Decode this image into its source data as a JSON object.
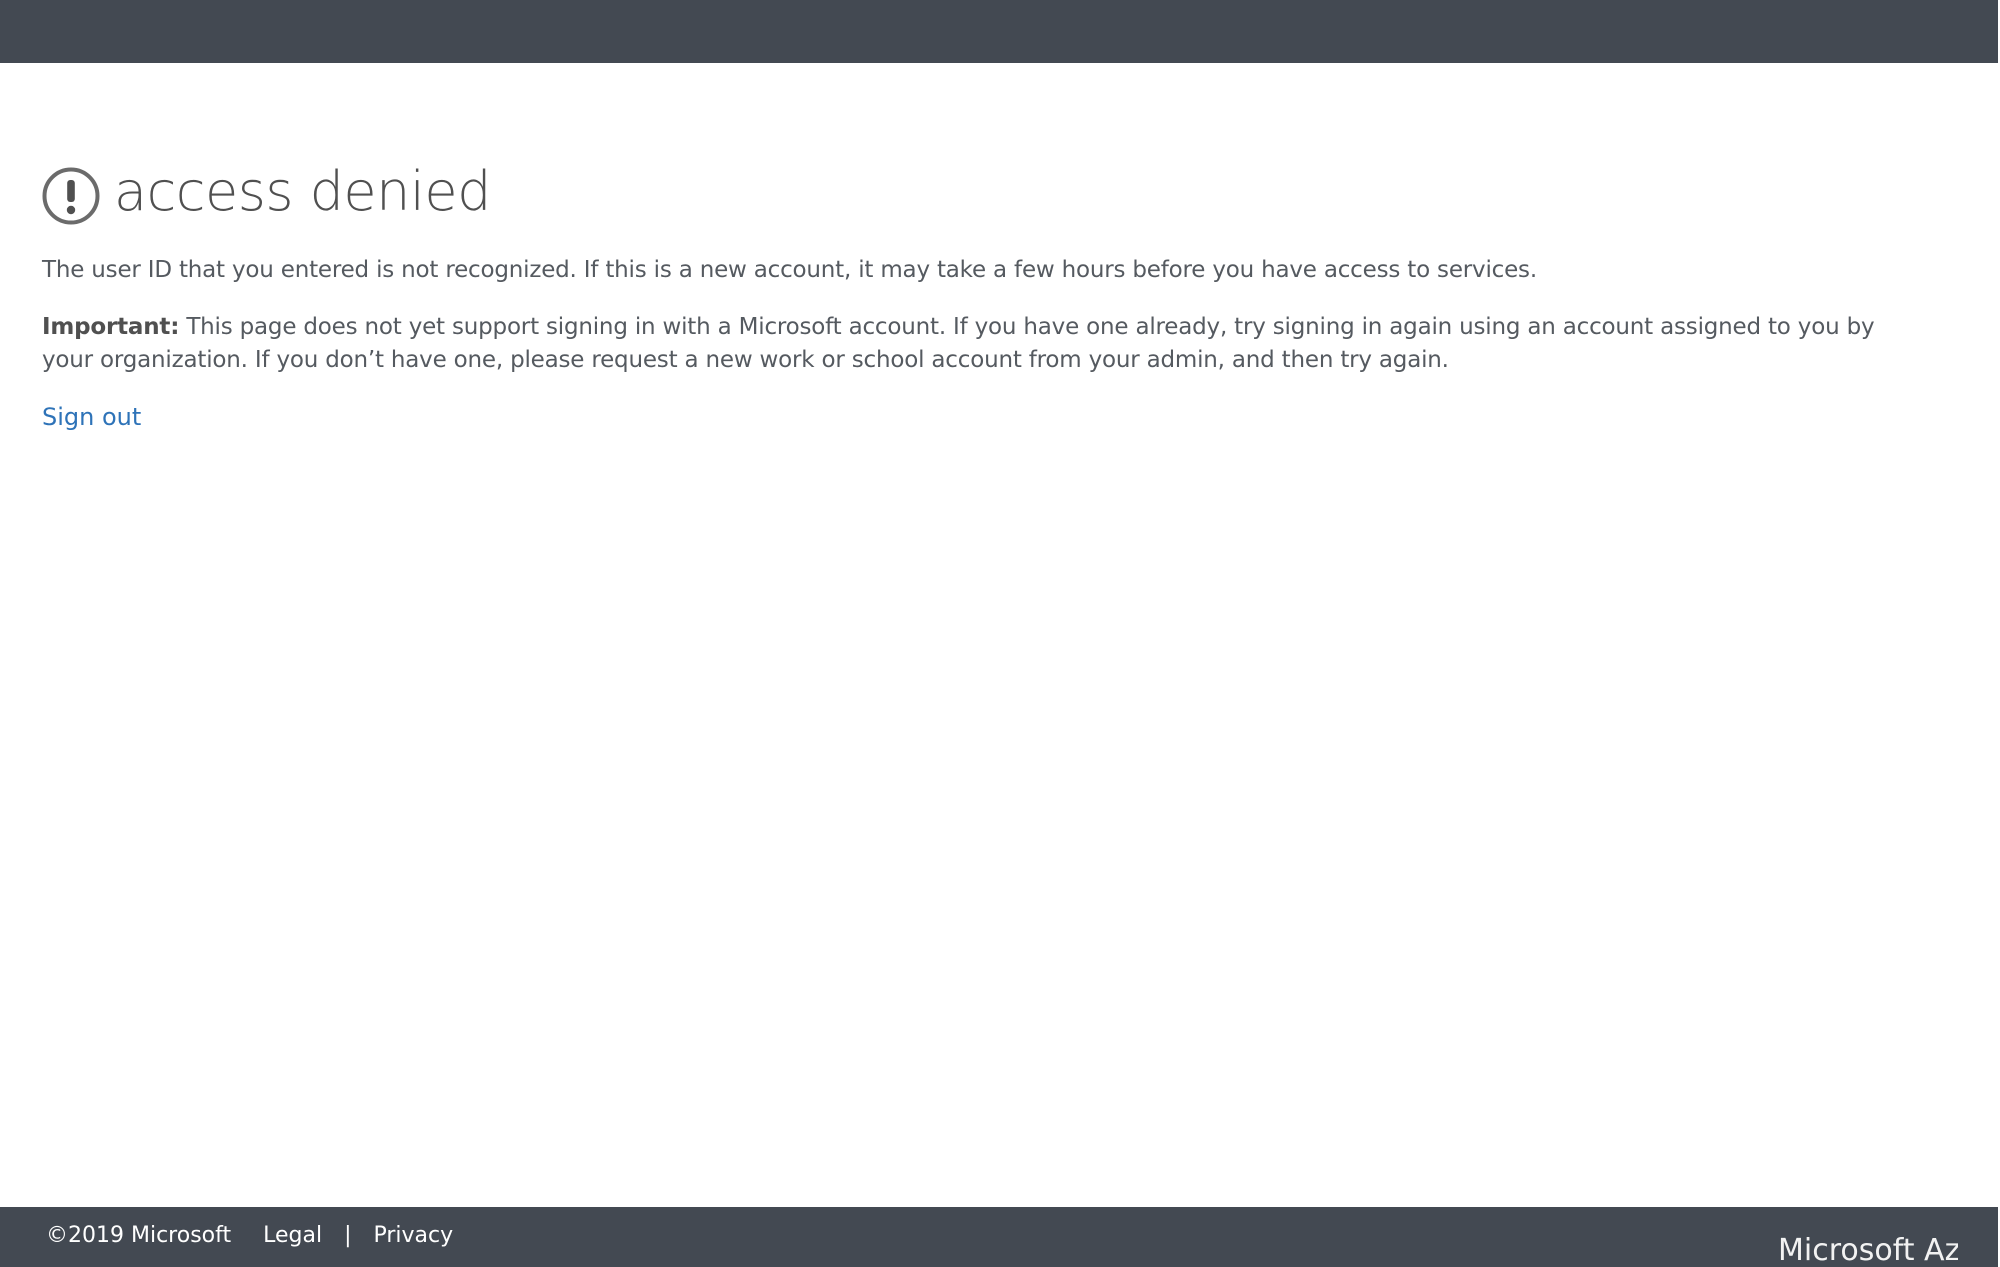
{
  "colors": {
    "header_bg": "#434952",
    "footer_bg": "#434952",
    "text": "#505050",
    "link": "#2e73b8"
  },
  "header": {},
  "main": {
    "icon": "exclamation-circle-icon",
    "title": "access denied",
    "message": "The user ID that you entered is not recognized. If this is a new account, it may take a few hours before you have access to services.",
    "important_label": "Important:",
    "important_text": " This page does not yet support signing in with a Microsoft account. If you have one already, try signing in again using an account assigned to you by your organization. If you don’t have one, please request a new work or school account from your admin, and then try again.",
    "sign_out_label": "Sign out"
  },
  "footer": {
    "copyright": "©2019 Microsoft",
    "legal_label": "Legal",
    "separator": "|",
    "privacy_label": "Privacy",
    "brand_text": "Microsoft Az"
  }
}
